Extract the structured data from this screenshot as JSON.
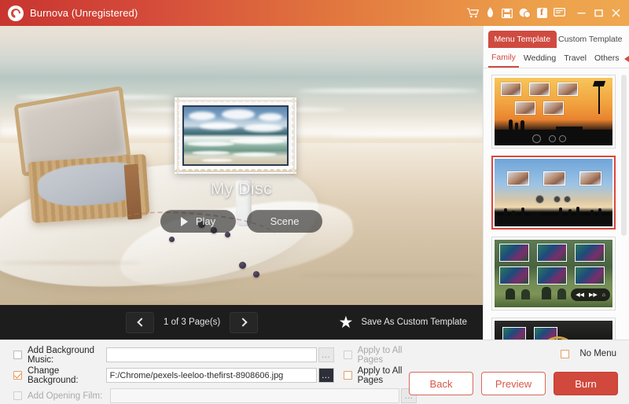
{
  "titlebar": {
    "app_title": "Burnova (Unregistered)",
    "logo_icon": "burnova-disc-logo",
    "tools": [
      {
        "name": "cart-icon",
        "glyph": "cart"
      },
      {
        "name": "key-icon",
        "glyph": "key"
      },
      {
        "name": "register-icon",
        "glyph": "register"
      },
      {
        "name": "chat-icon",
        "glyph": "chat"
      },
      {
        "name": "facebook-icon",
        "glyph": "facebook"
      },
      {
        "name": "feedback-icon",
        "glyph": "feedback"
      }
    ],
    "window_controls": [
      {
        "name": "minimize-button",
        "glyph": "minimize"
      },
      {
        "name": "maximize-button",
        "glyph": "maximize"
      },
      {
        "name": "close-button",
        "glyph": "close"
      }
    ]
  },
  "preview": {
    "disc_title": "My Disc",
    "play_label": "Play",
    "scene_label": "Scene",
    "background_description": "beach picnic basket on sand"
  },
  "pager": {
    "prev_label": "Previous page",
    "page_label": "1 of 3 Page(s)",
    "next_label": "Next page",
    "save_template_label": "Save As Custom Template",
    "star_glyph": "★"
  },
  "templates": {
    "tabs": [
      {
        "label": "Menu Template",
        "active": true
      },
      {
        "label": "Custom Template",
        "active": false
      }
    ],
    "categories": [
      {
        "label": "Family",
        "active": true
      },
      {
        "label": "Wedding",
        "active": false
      },
      {
        "label": "Travel",
        "active": false
      },
      {
        "label": "Others",
        "active": false
      }
    ],
    "items": [
      {
        "name": "template-sunset-family",
        "selected": false
      },
      {
        "name": "template-beach-blue",
        "selected": true
      },
      {
        "name": "template-forest-camping",
        "selected": false
      },
      {
        "name": "template-dark-gold",
        "selected": false
      }
    ]
  },
  "options": {
    "background_music": {
      "label": "Add Background Music:",
      "checked": false,
      "enabled": true,
      "value": "",
      "browse_label": "...",
      "apply_label": "Apply to All Pages",
      "apply_checked": false,
      "apply_enabled": false
    },
    "change_background": {
      "label": "Change Background:",
      "checked": true,
      "enabled": true,
      "value": "F:/Chrome/pexels-leeloo-thefirst-8908606.jpg",
      "browse_label": "...",
      "apply_label": "Apply to All Pages",
      "apply_checked": false,
      "apply_enabled": true
    },
    "opening_film": {
      "label": "Add Opening Film:",
      "checked": false,
      "enabled": false,
      "value": "",
      "browse_label": "..."
    }
  },
  "actions": {
    "no_menu_label": "No Menu",
    "no_menu_checked": false,
    "back_label": "Back",
    "preview_label": "Preview",
    "burn_label": "Burn"
  },
  "colors": {
    "brand_red": "#cf4b40",
    "brand_orange": "#efa850",
    "burn_button": "#d1483c",
    "selection_border": "#d9473c",
    "pager_bg": "#1d1d1d"
  }
}
